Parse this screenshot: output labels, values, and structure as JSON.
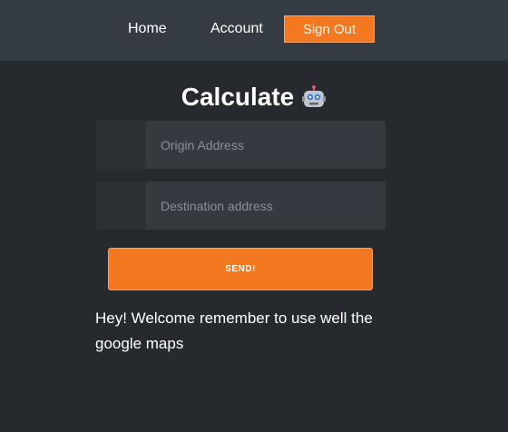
{
  "nav": {
    "home_label": "Home",
    "account_label": "Account",
    "signout_label": "Sign Out"
  },
  "main": {
    "title": "Calculate",
    "title_icon": "robot-icon",
    "origin_placeholder": "Origin Address",
    "destination_placeholder": "Destination address",
    "send_label": "SEND!",
    "message": "Hey! Welcome remember to use well the google maps"
  },
  "colors": {
    "accent": "#f47820",
    "navbar_bg": "#353b43",
    "page_bg": "#262a2e",
    "input_bg": "#353a41"
  }
}
